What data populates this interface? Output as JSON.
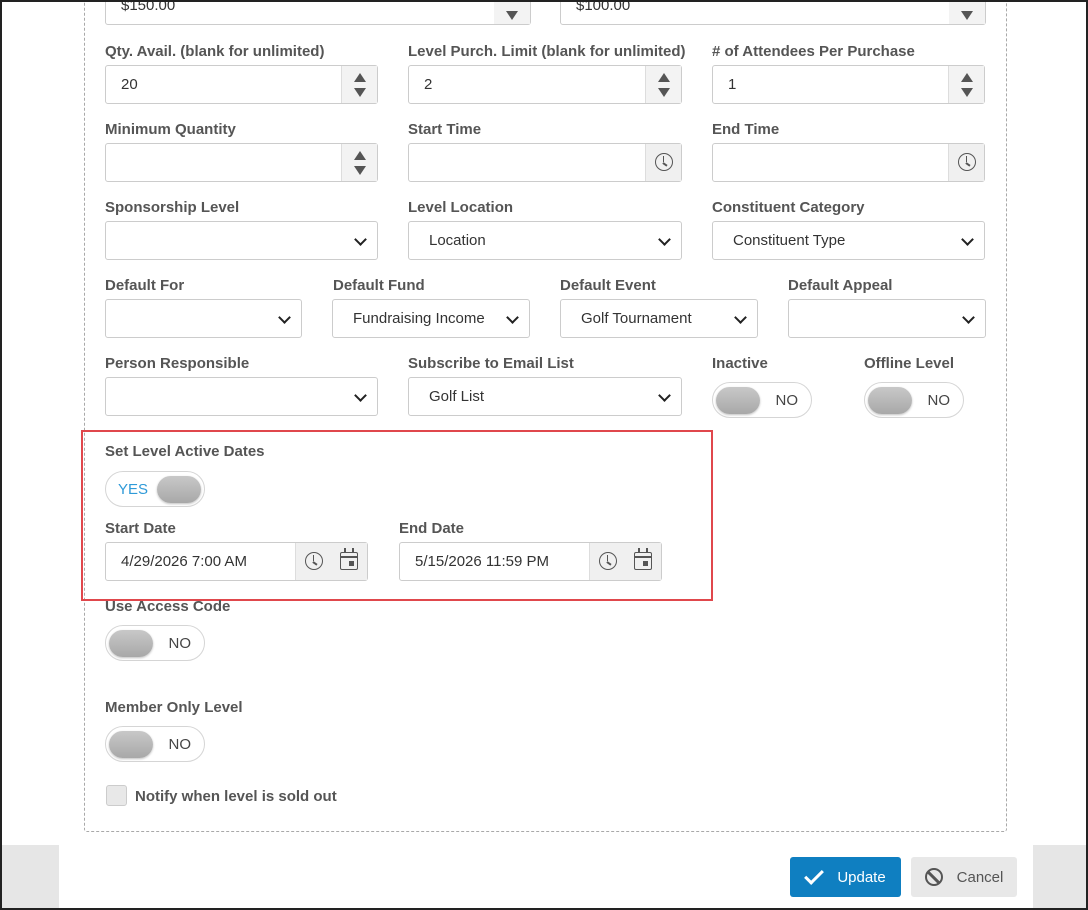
{
  "top_row": {
    "field_a_value": "$150.00",
    "field_b_value": "$100.00"
  },
  "row1": {
    "qty_label": "Qty. Avail. (blank for unlimited)",
    "qty_value": "20",
    "limit_label": "Level Purch. Limit (blank for unlimited)",
    "limit_value": "2",
    "attendees_label": "# of Attendees Per Purchase",
    "attendees_value": "1"
  },
  "row2": {
    "min_qty_label": "Minimum Quantity",
    "min_qty_value": "",
    "start_time_label": "Start Time",
    "start_time_value": "",
    "end_time_label": "End Time",
    "end_time_value": ""
  },
  "row3": {
    "sponsorship_label": "Sponsorship Level",
    "sponsorship_value": "",
    "location_label": "Level Location",
    "location_value": "Location",
    "constituent_label": "Constituent Category",
    "constituent_value": "Constituent Type"
  },
  "row4": {
    "default_for_label": "Default For",
    "default_for_value": "",
    "default_fund_label": "Default Fund",
    "default_fund_value": "Fundraising Income",
    "default_event_label": "Default Event",
    "default_event_value": "Golf Tournament",
    "default_appeal_label": "Default Appeal",
    "default_appeal_value": ""
  },
  "row5": {
    "person_label": "Person Responsible",
    "person_value": "",
    "email_list_label": "Subscribe to Email List",
    "email_list_value": "Golf List",
    "inactive_label": "Inactive",
    "inactive_state": "NO",
    "offline_label": "Offline Level",
    "offline_state": "NO"
  },
  "active_dates": {
    "label": "Set Level Active Dates",
    "state": "YES",
    "start_date_label": "Start Date",
    "start_date_value": "4/29/2026 7:00 AM",
    "end_date_label": "End Date",
    "end_date_value": "5/15/2026 11:59 PM"
  },
  "access_code": {
    "label": "Use Access Code",
    "state": "NO"
  },
  "member_only": {
    "label": "Member Only Level",
    "state": "NO"
  },
  "notify": {
    "label": "Notify when level is sold out",
    "checked": false
  },
  "footer": {
    "update_label": "Update",
    "cancel_label": "Cancel"
  },
  "colors": {
    "primary": "#0f7fc1",
    "highlight": "#e0474c",
    "toggle_yes": "#2f9ad8"
  }
}
